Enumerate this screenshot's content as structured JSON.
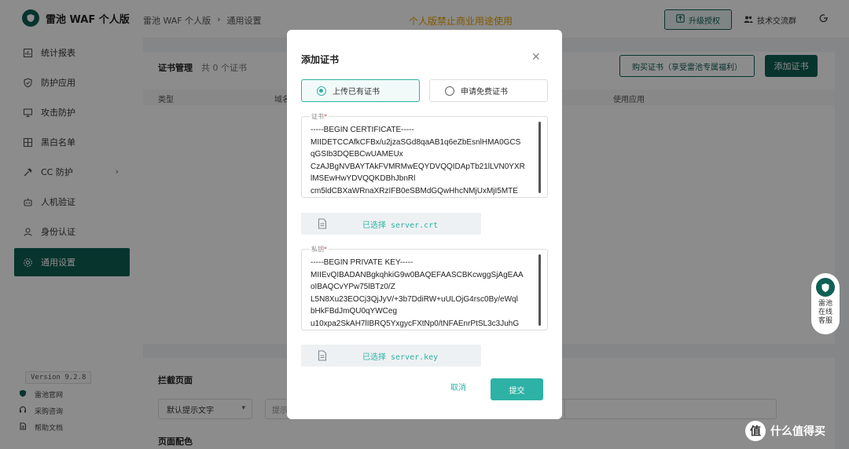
{
  "app": {
    "name": "雷池 WAF 个人版",
    "version": "Version 9.2.8"
  },
  "header": {
    "breadcrumb": [
      "雷池 WAF 个人版",
      "通用设置"
    ],
    "banner": "个人版禁止商业用途使用",
    "upgrade_label": "升级授权",
    "community_label": "技术交流群"
  },
  "sidebar": {
    "items": [
      {
        "label": "统计报表",
        "icon": "chart-icon"
      },
      {
        "label": "防护应用",
        "icon": "shield-icon"
      },
      {
        "label": "攻击防护",
        "icon": "monitor-icon"
      },
      {
        "label": "黑白名单",
        "icon": "list-icon"
      },
      {
        "label": "CC 防护",
        "icon": "hammer-icon"
      },
      {
        "label": "人机验证",
        "icon": "robot-icon"
      },
      {
        "label": "身份认证",
        "icon": "user-icon"
      },
      {
        "label": "通用设置",
        "icon": "gear-icon"
      }
    ],
    "footer_links": [
      "雷池官网",
      "采购咨询",
      "帮助文档"
    ]
  },
  "cert_card": {
    "title": "证书管理",
    "count": "共 0 个证书",
    "buy_label": "购买证书（享受雷池专属福利）",
    "add_label": "添加证书",
    "columns": [
      "类型",
      "域名",
      "使用应用"
    ]
  },
  "block_card": {
    "title": "拦截页面",
    "select_value": "默认提示文字",
    "hint_placeholder": "提示",
    "color_title": "页面配色"
  },
  "modal": {
    "title": "添加证书",
    "options": [
      "上传已有证书",
      "申请免费证书"
    ],
    "selected_option": "上传已有证书",
    "cert_label": "证书",
    "cert_text": "-----BEGIN CERTIFICATE-----\nMIIDETCCAfkCFBx/u2jzaSGd8qaAB1q6eZbEsnlHMA0GCS\nqGSIb3DQEBCwUAMEUx\nCzAJBgNVBAYTAkFVMRMwEQYDVQQIDApTb21lLVN0YXR\nlMSEwHwYDVQQKDBhJbnRl\ncm5ldCBXaWRnaXRzIFB0eSBMdGQwHhcNMjUxMjI5MTE",
    "cert_file_prefix": "已选择",
    "cert_file": "server.crt",
    "key_label": "私钥",
    "key_text": "-----BEGIN PRIVATE KEY-----\nMIIEvQIBADANBgkqhkiG9w0BAQEFAASCBKcwggSjAgEAA\noIBAQCvYPw75lBTz0/Z\nL5N8Xu23EOCj3QjJyV/+3b7DdiRW+uULOjG4rsc0By/eWql\nbHkFBdJmQU0qYWCeg\nu10xpa2SkAH7lIBRQ5YxgycFXtNp0/tNFAEnrPtSL3c3JuhG",
    "key_file_prefix": "已选择",
    "key_file": "server.key",
    "cancel_label": "取消",
    "submit_label": "提交"
  },
  "service_widget": {
    "label": "雷池在线客服"
  },
  "watermark": {
    "icon_text": "值",
    "label": "什么值得买"
  },
  "colors": {
    "brand": "#0f5f54",
    "accent": "#2db2a5",
    "banner": "#e7a400"
  }
}
